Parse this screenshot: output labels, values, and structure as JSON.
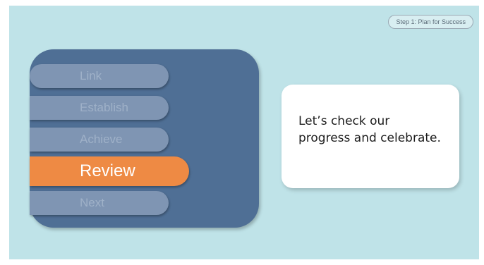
{
  "step_badge": "Step 1: Plan for Success",
  "menu": {
    "items": [
      {
        "label": "Link"
      },
      {
        "label": "Establish"
      },
      {
        "label": "Achieve"
      },
      {
        "label": "Review"
      },
      {
        "label": "Next"
      }
    ],
    "active": "Review"
  },
  "callout": {
    "text": "Let’s check our progress and celebrate."
  },
  "colors": {
    "background": "#bfe3e8",
    "panel": "#4f6f95",
    "inactive_item": "#7f95b3",
    "active_item": "#ee8a44"
  }
}
